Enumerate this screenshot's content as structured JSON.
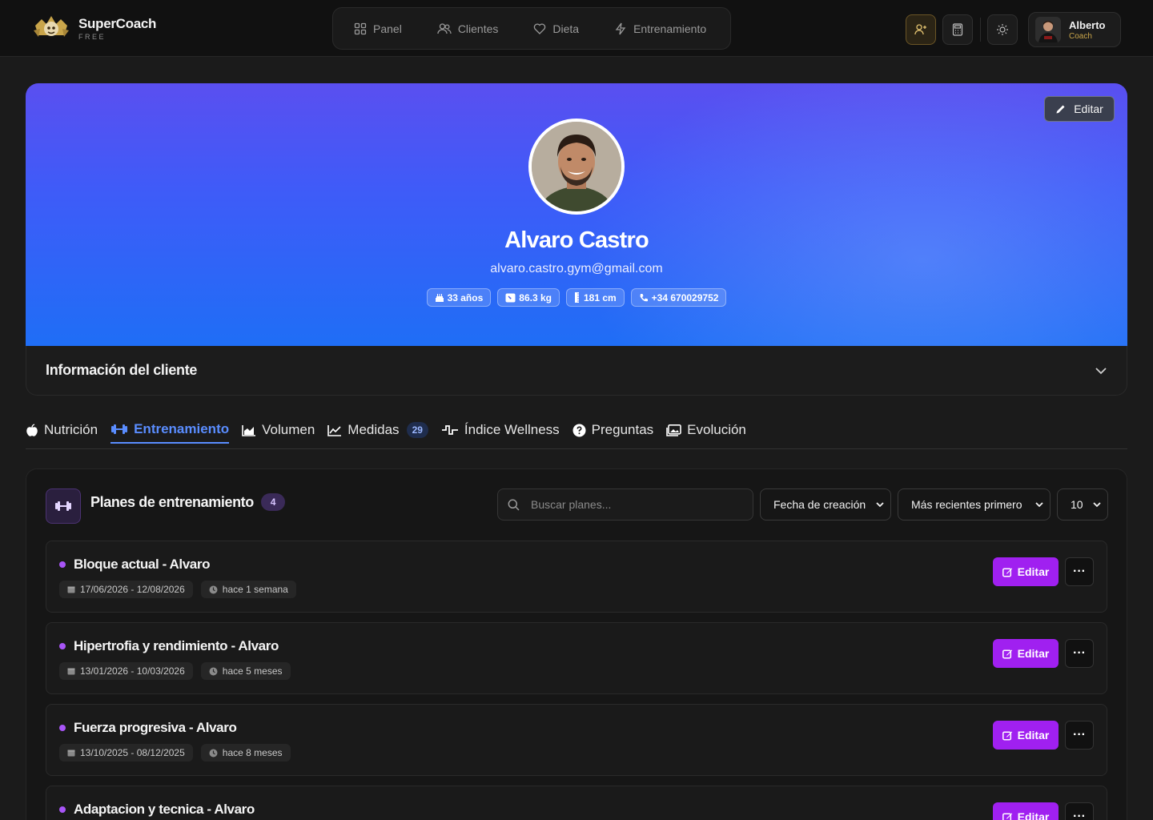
{
  "app": {
    "name": "SuperCoach",
    "plan": "FREE"
  },
  "nav": [
    {
      "label": "Panel",
      "icon": "grid-icon"
    },
    {
      "label": "Clientes",
      "icon": "users-icon"
    },
    {
      "label": "Dieta",
      "icon": "heart-icon"
    },
    {
      "label": "Entrenamiento",
      "icon": "bolt-icon"
    }
  ],
  "user": {
    "name": "Alberto",
    "role": "Coach"
  },
  "client": {
    "edit_label": "Editar",
    "name": "Alvaro Castro",
    "email": "alvaro.castro.gym@gmail.com",
    "age": "33 años",
    "weight": "86.3 kg",
    "height": "181 cm",
    "phone": "+34 670029752"
  },
  "info_section": {
    "title": "Información del cliente"
  },
  "tabs": [
    {
      "label": "Nutrición"
    },
    {
      "label": "Entrenamiento",
      "active": true
    },
    {
      "label": "Volumen"
    },
    {
      "label": "Medidas",
      "badge": "29"
    },
    {
      "label": "Índice Wellness"
    },
    {
      "label": "Preguntas"
    },
    {
      "label": "Evolución"
    }
  ],
  "plans": {
    "title": "Planes de entrenamiento",
    "count": "4",
    "search_placeholder": "Buscar planes...",
    "sort_field": "Fecha de creación",
    "sort_order": "Más recientes primero",
    "page_size": "10",
    "edit_label": "Editar",
    "more_label": "···",
    "items": [
      {
        "name": "Bloque actual - Alvaro",
        "dates": "17/06/2026 - 12/08/2026",
        "ago": "hace 1 semana"
      },
      {
        "name": "Hipertrofia y rendimiento - Alvaro",
        "dates": "13/01/2026 - 10/03/2026",
        "ago": "hace 5 meses"
      },
      {
        "name": "Fuerza progresiva - Alvaro",
        "dates": "13/10/2025 - 08/12/2025",
        "ago": "hace 8 meses"
      },
      {
        "name": "Adaptacion y tecnica - Alvaro",
        "dates": "",
        "ago": ""
      }
    ]
  },
  "colors": {
    "accent_blue": "#5a8dff",
    "accent_purple": "#a020f0",
    "gold": "#c9a54a",
    "background": "#1b1b1b"
  }
}
